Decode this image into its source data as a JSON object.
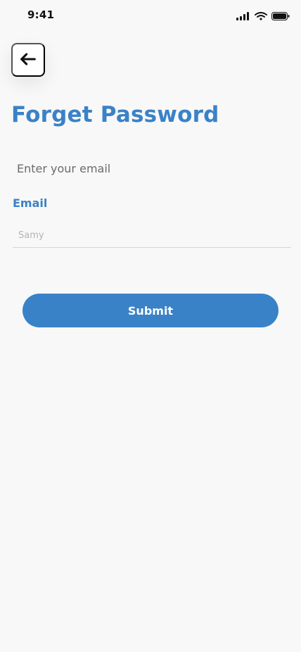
{
  "status_bar": {
    "time": "9:41",
    "icons": [
      "signal-icon",
      "wifi-icon",
      "battery-icon"
    ]
  },
  "header": {
    "back_icon": "arrow-left-icon"
  },
  "main": {
    "title": "Forget Password",
    "subtitle": "Enter your email",
    "email_label": "Email",
    "email_placeholder": "Samy",
    "submit_label": "Submit"
  },
  "colors": {
    "accent": "#3a82c7",
    "background": "#f8f8f8",
    "text_muted": "#6b6b6b"
  }
}
